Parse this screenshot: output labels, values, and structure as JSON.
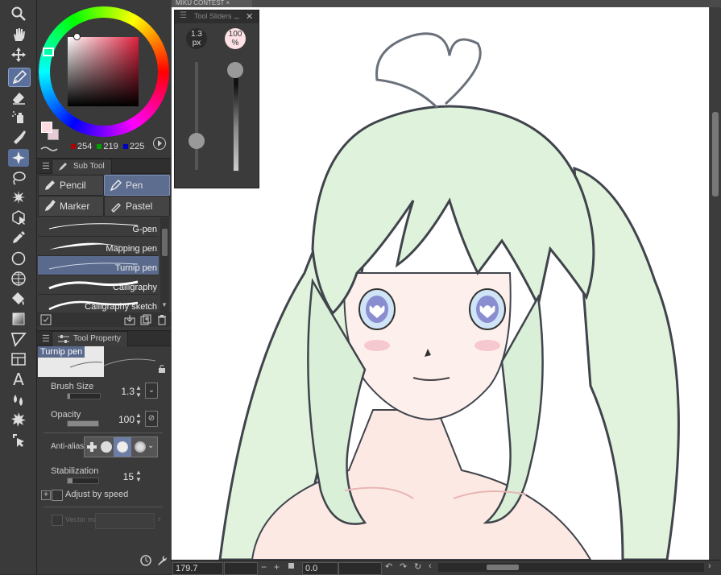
{
  "document": {
    "tab_title": "MIKU CONTEST",
    "close": "×"
  },
  "toolbar": {
    "tools": [
      "zoom-icon",
      "hand-icon",
      "move-icon",
      "pen-icon",
      "eraser-icon",
      "fill-spray-icon",
      "brush-icon",
      "sparkle-icon",
      "lasso-icon",
      "magic-wand-icon",
      "object-select-icon",
      "eyedropper-icon",
      "circle-icon",
      "grid-icon",
      "paint-bucket-icon",
      "gradient-icon",
      "ruler-icon",
      "frame-icon",
      "text-icon",
      "liquify-icon",
      "special-ruler-icon",
      "arrow-select-icon"
    ],
    "active_tool": "pen-icon"
  },
  "color": {
    "rgb_r": "254",
    "rgb_g": "219",
    "rgb_b": "225",
    "main_color": "#fedbe1",
    "sub_color": "#e8c9d6"
  },
  "subtool": {
    "panel_title": "Sub Tool",
    "categories": [
      "Pencil",
      "Pen",
      "Marker",
      "Pastel"
    ],
    "selected_category": "Pen",
    "brushes": [
      "G-pen",
      "Mapping pen",
      "Turnip pen",
      "Calligraphy",
      "Calligraphy sketch"
    ],
    "selected_brush": "Turnip pen"
  },
  "toolproperty": {
    "panel_title": "Tool Property",
    "preview_name": "Turnip pen",
    "brush_size_label": "Brush Size",
    "brush_size_value": "1.3",
    "brush_size_fraction": 0.08,
    "opacity_label": "Opacity",
    "opacity_value": "100",
    "opacity_fraction": 1.0,
    "antialias_label": "Anti-aliasin",
    "stabilization_label": "Stabilization",
    "stabilization_value": "15",
    "stabilization_fraction": 0.15,
    "adjust_speed_label": "Adjust by speed",
    "vector_label": "Vector ma"
  },
  "toolsliders": {
    "title": "Tool Sliders",
    "size_value": "1.3",
    "size_unit": "px",
    "opacity_value": "100",
    "opacity_unit": "%",
    "size_fraction": 0.23,
    "opacity_fraction": 1.0
  },
  "status": {
    "zoom": "179.7",
    "rotation": "0.0"
  }
}
